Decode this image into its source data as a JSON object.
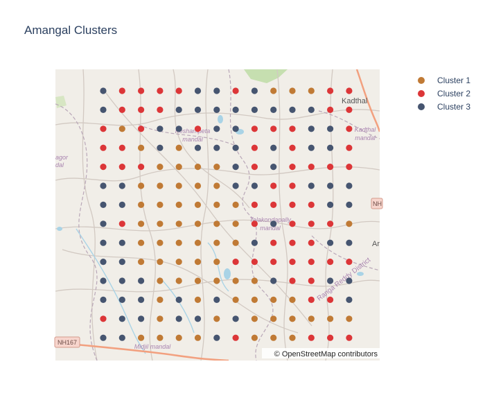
{
  "chart_data": {
    "type": "scatter",
    "title": "Amangal Clusters",
    "attribution": "© OpenStreetMap contributors",
    "basemap_labels": {
      "town_kadthal": "Kadthal",
      "mandal_keshampeta": [
        "Keshampeta",
        "mandal"
      ],
      "mandal_kadthal": [
        "Kadthal",
        "mandal"
      ],
      "mandal_talakondapally": [
        "Talakondapally",
        "mandal"
      ],
      "mandal_midjil": "Midjil mandal",
      "mandal_left_partial": [
        "agor",
        "dal"
      ],
      "district": "Ranga Reddy District",
      "highway_nh167": "NH167",
      "highway_right": "NH",
      "place_right_partial": "Ar"
    },
    "colors": {
      "Cluster 1": "#c07a35",
      "Cluster 2": "#dc3638",
      "Cluster 3": "#465570",
      "land": "#f1eee8",
      "road": "#d2c9c2",
      "water": "#a9d3e6",
      "park": "#c6dfb0",
      "highway": "#f2a07f"
    },
    "legend": {
      "placement": "top-right",
      "items": [
        {
          "label": "Cluster 1",
          "color": "#c07a35"
        },
        {
          "label": "Cluster 2",
          "color": "#dc3638"
        },
        {
          "label": "Cluster 3",
          "color": "#465570"
        }
      ]
    },
    "grid_columns": 13,
    "grid_rows": 14,
    "grid_legend": "each string is one row (north to south), one character per column (west to east): 1 = Cluster 1, 2 = Cluster 2, 3 = Cluster 3, . = no point",
    "grid": [
      "32222332311122",
      "32223333333322",
      "21233233222332",
      "22131333232332",
      "22211113232222",
      "33111113322333",
      "33111111222233",
      "32111111232221",
      "33111111322233",
      "33111112222222",
      "33311111132233",
      "33313131111223",
      "23313313111111",
      "33111132111222"
    ]
  }
}
